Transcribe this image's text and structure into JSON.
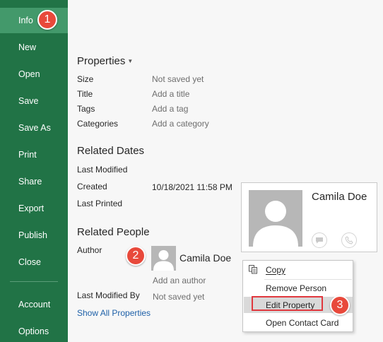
{
  "sidebar": {
    "items": [
      {
        "label": "Info",
        "active": true
      },
      {
        "label": "New"
      },
      {
        "label": "Open"
      },
      {
        "label": "Save"
      },
      {
        "label": "Save As"
      },
      {
        "label": "Print"
      },
      {
        "label": "Share"
      },
      {
        "label": "Export"
      },
      {
        "label": "Publish"
      },
      {
        "label": "Close"
      },
      {
        "label": "Account"
      },
      {
        "label": "Options"
      }
    ]
  },
  "steps": [
    "1",
    "2",
    "3"
  ],
  "properties": {
    "title": "Properties",
    "dropdown_icon": "caret-down-icon",
    "rows": [
      {
        "label": "Size",
        "value": "Not saved yet"
      },
      {
        "label": "Title",
        "value": "Add a title"
      },
      {
        "label": "Tags",
        "value": "Add a tag"
      },
      {
        "label": "Categories",
        "value": "Add a category"
      }
    ]
  },
  "related_dates": {
    "title": "Related Dates",
    "rows": [
      {
        "label": "Last Modified",
        "value": ""
      },
      {
        "label": "Created",
        "value": "10/18/2021 11:58 PM"
      },
      {
        "label": "Last Printed",
        "value": ""
      }
    ]
  },
  "related_people": {
    "title": "Related People",
    "author_label": "Author",
    "author_name": "Camila Doe",
    "add_author": "Add an author",
    "last_modified_by_label": "Last Modified By",
    "last_modified_by_value": "Not saved yet",
    "show_all": "Show All Properties"
  },
  "contact_card": {
    "name": "Camila Doe",
    "icons": [
      "chat-icon",
      "phone-icon"
    ]
  },
  "context_menu": {
    "items": [
      {
        "label": "Copy",
        "underline": "C",
        "icon": "copy-icon"
      },
      {
        "label": "Remove Person",
        "underline": "R"
      },
      {
        "label": "Edit Property",
        "underline": "E",
        "highlight": true
      },
      {
        "label": "Open Contact Card",
        "underline": "t"
      }
    ]
  },
  "colors": {
    "sidebar": "#217346",
    "sidebar_active": "#43996b",
    "badge": "#e8493b",
    "link": "#1e60a8",
    "highlight_box": "#e0383e"
  }
}
